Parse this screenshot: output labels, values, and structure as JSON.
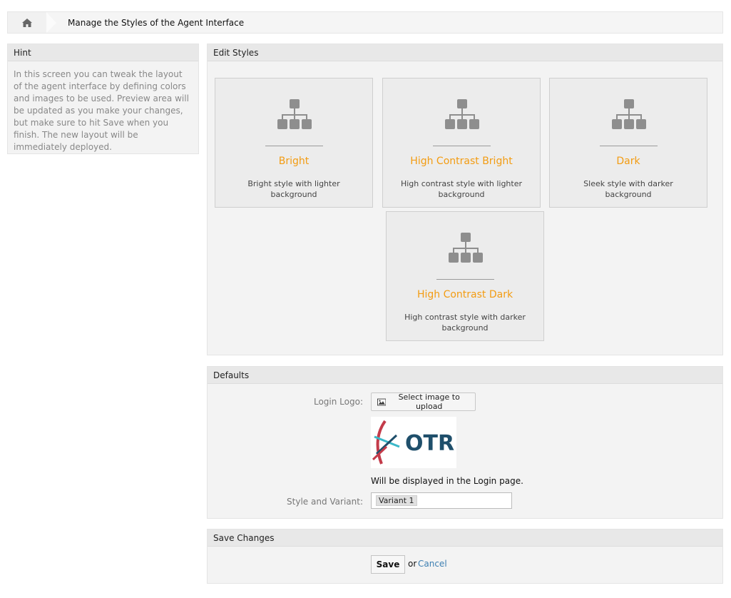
{
  "breadcrumb": {
    "home_icon": "home-icon",
    "title": "Manage the Styles of the Agent Interface"
  },
  "hint": {
    "header": "Hint",
    "text": "In this screen you can tweak the layout of the agent interface by defining colors and images to be used. Preview area will be updated as you make your changes, but make sure to hit Save when you finish. The new layout will be immediately deployed."
  },
  "edit_styles": {
    "header": "Edit Styles",
    "accent_color": "#f39c12",
    "styles": [
      {
        "name": "Bright",
        "description": "Bright style with lighter background",
        "icon": "sitemap-icon"
      },
      {
        "name": "High Contrast Bright",
        "description": "High contrast style with lighter background",
        "icon": "sitemap-icon"
      },
      {
        "name": "Dark",
        "description": "Sleek style with darker background",
        "icon": "sitemap-icon"
      },
      {
        "name": "High Contrast Dark",
        "description": "High contrast style with darker background",
        "icon": "sitemap-icon"
      }
    ]
  },
  "defaults": {
    "header": "Defaults",
    "login_logo_label": "Login Logo:",
    "upload_button_label": "Select image to upload",
    "upload_icon": "image-icon",
    "logo_text": "OTR",
    "logo_note": "Will be displayed in the Login page.",
    "style_variant_label": "Style and Variant:",
    "style_variant_value": "Variant 1"
  },
  "save_changes": {
    "header": "Save Changes",
    "save_label": "Save",
    "or_text": "or",
    "cancel_label": "Cancel",
    "link_color": "#3d7fb2"
  }
}
